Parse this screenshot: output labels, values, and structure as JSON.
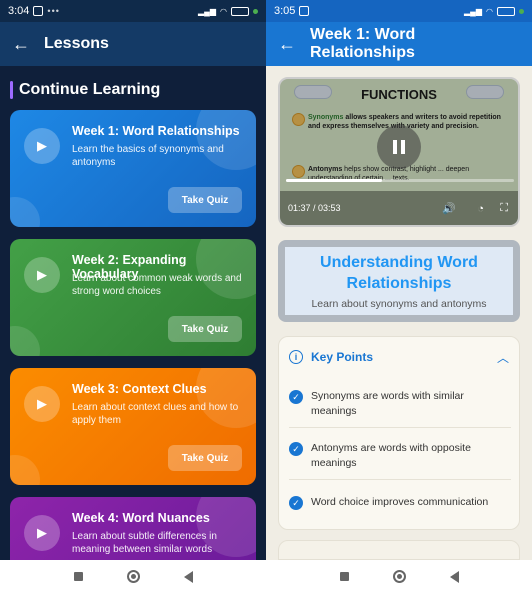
{
  "left": {
    "status": {
      "time": "3:04"
    },
    "appbar": {
      "title": "Lessons"
    },
    "section_title": "Continue Learning",
    "cards": [
      {
        "title": "Week 1: Word Relationships",
        "desc": "Learn the basics of synonyms and antonyms",
        "button": "Take Quiz"
      },
      {
        "title": "Week 2: Expanding Vocabulary",
        "desc": "Learn about common weak words and strong word choices",
        "button": "Take Quiz"
      },
      {
        "title": "Week 3: Context Clues",
        "desc": "Learn about context clues and how to apply them",
        "button": "Take Quiz"
      },
      {
        "title": "Week 4: Word Nuances",
        "desc": "Learn about subtle differences in meaning between similar words",
        "button": "Take Quiz"
      }
    ]
  },
  "right": {
    "status": {
      "time": "3:05"
    },
    "appbar": {
      "title": "Week 1: Word Relationships"
    },
    "video": {
      "slide_title": "FUNCTIONS",
      "slide_line1_term": "Synonyms",
      "slide_line1_rest": " allows speakers and writers to avoid repetition and express themselves with variety and precision.",
      "slide_line2_term": "Antonyms",
      "slide_line2_rest": " helps show contrast, highlight ... deepen understanding of certain ... texts.",
      "time": "01:37 / 03:53",
      "progress": 0.42
    },
    "topic": {
      "title": "Understanding Word Relationships",
      "subtitle": "Learn about synonyms and antonyms"
    },
    "key_points": {
      "title": "Key Points",
      "items": [
        "Synonyms are words with similar meanings",
        "Antonyms are words with opposite meanings",
        "Word choice improves communication"
      ]
    }
  }
}
